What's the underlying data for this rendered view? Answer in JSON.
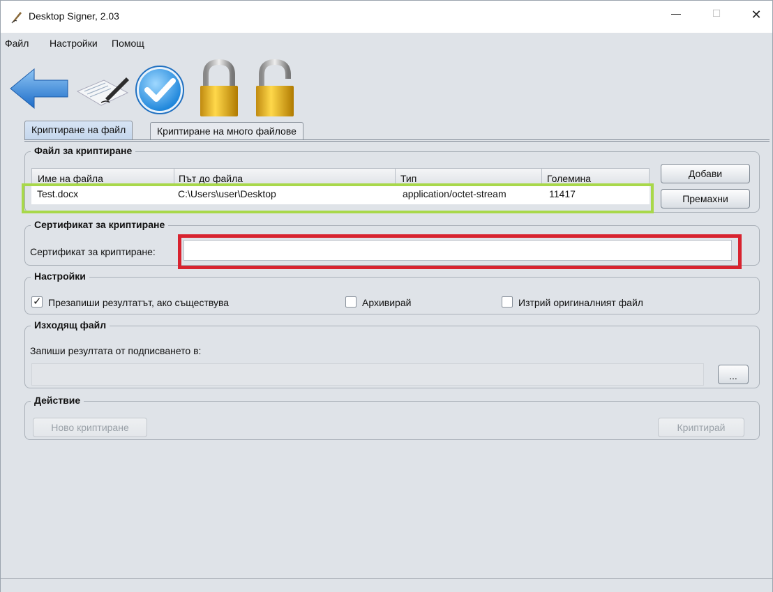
{
  "window": {
    "title": "Desktop Signer, 2.03",
    "min_glyph": "—",
    "max_glyph": "☐",
    "close_glyph": "✕"
  },
  "menu": {
    "items": [
      "Файл",
      "Настройки",
      "Помощ"
    ]
  },
  "toolbar": {
    "buttons": [
      {
        "icon": "back-arrow-icon"
      },
      {
        "icon": "sign-document-icon"
      },
      {
        "icon": "verify-checkmark-icon"
      },
      {
        "icon": "lock-closed-icon"
      },
      {
        "icon": "lock-open-icon"
      }
    ]
  },
  "tabs": [
    {
      "label": "Криптиране на файл",
      "active": true
    },
    {
      "label": "Криптиране на много файлове",
      "active": false
    }
  ],
  "file_group": {
    "title": "Файл за криптиране",
    "columns": [
      "Име на файла",
      "Път до файла",
      "Тип",
      "Големина"
    ],
    "rows": [
      {
        "name": "Test.docx",
        "path": "C:\\Users\\user\\Desktop",
        "type": "application/octet-stream",
        "size": "11417"
      }
    ],
    "add_label": "Добави",
    "remove_label": "Премахни"
  },
  "cert_group": {
    "title": "Сертификат за криптиране",
    "field_label": "Сертификат за криптиране:",
    "field_value": ""
  },
  "settings_group": {
    "title": "Настройки",
    "overwrite": {
      "label": "Презапиши резултатът, ако съществува",
      "checked": true
    },
    "archive": {
      "label": "Архивирай",
      "checked": false
    },
    "delete_original": {
      "label": "Изтрий оригиналният файл",
      "checked": false
    }
  },
  "output_group": {
    "title": "Изходящ файл",
    "field_label": "Запиши резултата от подписването в:",
    "field_value": "",
    "browse_label": "..."
  },
  "action_group": {
    "title": "Действие",
    "new_label": "Ново криптиране",
    "encrypt_label": "Криптирай"
  },
  "colors": {
    "highlight_table": "#a8d84a",
    "highlight_cert": "#d8232f"
  }
}
